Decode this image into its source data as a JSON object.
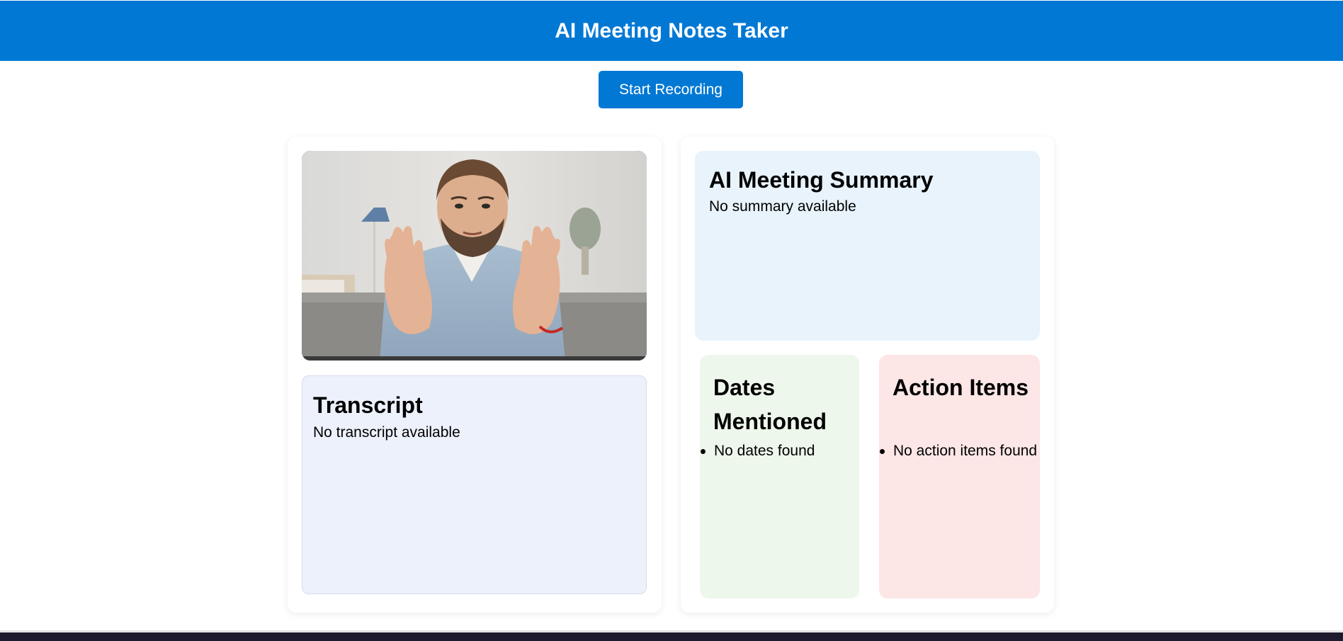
{
  "header": {
    "title": "AI Meeting Notes Taker"
  },
  "controls": {
    "record_label": "Start Recording"
  },
  "video": {
    "description_icon": "video-feed"
  },
  "transcript": {
    "heading": "Transcript",
    "text": "No transcript available"
  },
  "summary": {
    "heading": "AI Meeting Summary",
    "text": "No summary available"
  },
  "dates": {
    "heading": "Dates Mentioned",
    "items": [
      "No dates found"
    ]
  },
  "action_items": {
    "heading": "Action Items",
    "items": [
      "No action items found"
    ]
  },
  "colors": {
    "brand": "#0078d4",
    "summary_bg": "#e8f3fc",
    "transcript_bg": "#edf1fc",
    "dates_bg": "#eef7ec",
    "actions_bg": "#fce6e6"
  }
}
